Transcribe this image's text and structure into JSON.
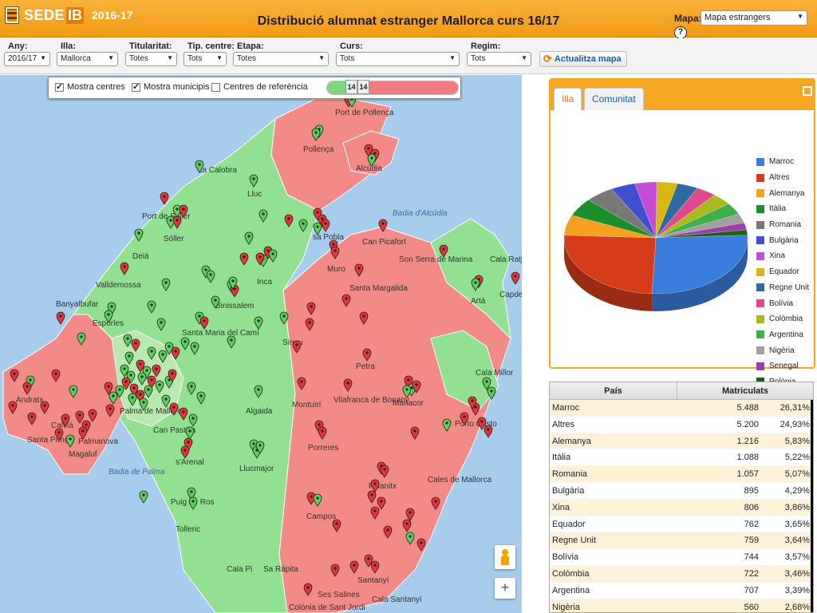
{
  "header": {
    "logo_text": "SEDE",
    "logo_ib": "IB",
    "year": "2016-17",
    "title": "Distribució alumnat estranger Mallorca curs 16/17",
    "mapa_label": "Mapa:",
    "mapa_value": "Mapa estrangers",
    "help": "?"
  },
  "filters": [
    {
      "label": "Any:",
      "value": "2016/17"
    },
    {
      "label": "Illa:",
      "value": "Mallorca"
    },
    {
      "label": "Titularitat:",
      "value": "Totes"
    },
    {
      "label": "Tip. centre:",
      "value": "Tots"
    },
    {
      "label": "Etapa:",
      "value": "Totes"
    },
    {
      "label": "Curs:",
      "value": "Tots"
    },
    {
      "label": "Regim:",
      "value": "Tots"
    }
  ],
  "refresh_label": "Actualitza mapa",
  "map": {
    "controls": {
      "show_centres": "Mostra centres",
      "show_municipis": "Mostra municipis",
      "ref_centres": "Centres de referència",
      "slider_left": "14",
      "slider_right": "14"
    },
    "zoom_in": "+",
    "labels": [
      {
        "id": "port-pollenca",
        "text": "Port de Pollença"
      },
      {
        "id": "pollenca",
        "text": "Pollença"
      },
      {
        "id": "alcudia",
        "text": "Alcúdia"
      },
      {
        "id": "la-calobra",
        "text": "La Calobra"
      },
      {
        "id": "lluc",
        "text": "Lluc"
      },
      {
        "id": "badia-alcudia",
        "text": "Badia d'Alcúdia"
      },
      {
        "id": "port-soller",
        "text": "Port de Sóller"
      },
      {
        "id": "soller",
        "text": "Sóller"
      },
      {
        "id": "deia",
        "text": "Deià"
      },
      {
        "id": "sa-pobla",
        "text": "sa Pobla"
      },
      {
        "id": "can-picafort",
        "text": "Can Picafort"
      },
      {
        "id": "valldemossa",
        "text": "Valldemossa"
      },
      {
        "id": "muro",
        "text": "Muro"
      },
      {
        "id": "son-serra",
        "text": "Son Serra de Marina"
      },
      {
        "id": "cala-ratjada",
        "text": "Cala Ratjada"
      },
      {
        "id": "inca",
        "text": "Inca"
      },
      {
        "id": "binissalem",
        "text": "Binissalem"
      },
      {
        "id": "santa-margalida",
        "text": "Santa Margalida"
      },
      {
        "id": "arta",
        "text": "Artà"
      },
      {
        "id": "banyalbufar",
        "text": "Banyalbufar"
      },
      {
        "id": "esporles",
        "text": "Esporles"
      },
      {
        "id": "santa-maria",
        "text": "Santa Maria del Camí"
      },
      {
        "id": "sineu",
        "text": "Sineu"
      },
      {
        "id": "petra",
        "text": "Petra"
      },
      {
        "id": "capdepera",
        "text": "Capdepera"
      },
      {
        "id": "cala-millor",
        "text": "Cala Millor"
      },
      {
        "id": "andratx",
        "text": "Andratx"
      },
      {
        "id": "palma",
        "text": "Palma de Mallorca"
      },
      {
        "id": "algaida",
        "text": "Algaida"
      },
      {
        "id": "montuiri",
        "text": "Montuïri"
      },
      {
        "id": "vilafranca",
        "text": "Vilafranca de Bonany"
      },
      {
        "id": "manacor",
        "text": "Manacor"
      },
      {
        "id": "porto-cristo",
        "text": "Porto Cristo"
      },
      {
        "id": "calvia",
        "text": "Calvià"
      },
      {
        "id": "can-pastilla",
        "text": "Can Pastilla"
      },
      {
        "id": "santa-ponsa",
        "text": "Santa Ponça"
      },
      {
        "id": "palmanova",
        "text": "Palmanova"
      },
      {
        "id": "magaluf",
        "text": "Magaluf"
      },
      {
        "id": "badia-palma",
        "text": "Badia de Palma"
      },
      {
        "id": "arenal",
        "text": "s'Arenal"
      },
      {
        "id": "llucmajor",
        "text": "Llucmajor"
      },
      {
        "id": "porreres",
        "text": "Porreres"
      },
      {
        "id": "felanitx",
        "text": "Felanitx"
      },
      {
        "id": "cales-mallorca",
        "text": "Cales de Mallorca"
      },
      {
        "id": "puig-ros",
        "text": "Puig de Ros"
      },
      {
        "id": "campos",
        "text": "Campos"
      },
      {
        "id": "toleric",
        "text": "Tolleric"
      },
      {
        "id": "cala-pi",
        "text": "Cala Pi"
      },
      {
        "id": "sa-rapita",
        "text": "Sa Ràpita"
      },
      {
        "id": "santanyi",
        "text": "Santanyí"
      },
      {
        "id": "ses-salines",
        "text": "Ses Salines"
      },
      {
        "id": "cala-santanyi",
        "text": "Cala Santanyí"
      },
      {
        "id": "colonia",
        "text": "Colònia de Sant Jordi"
      }
    ]
  },
  "panel": {
    "tabs": [
      "Illa",
      "Comunitat"
    ],
    "table_headers": {
      "country": "País",
      "count": "Matriculats"
    }
  },
  "chart_data": {
    "type": "pie",
    "title": "",
    "categories": [
      "Marroc",
      "Altres",
      "Alemanya",
      "Itàlia",
      "Romania",
      "Bulgària",
      "Xina",
      "Equador",
      "Regne Unit",
      "Bolívia",
      "Colòmbia",
      "Argentina",
      "Nigèria",
      "Senegal",
      "Polònia"
    ],
    "colors": [
      "#3b7ddd",
      "#d63c1c",
      "#f5a020",
      "#1c8f2a",
      "#777777",
      "#3f4fcf",
      "#c64cd6",
      "#d8b80e",
      "#2e6aa3",
      "#e04a8a",
      "#a7bb1e",
      "#3fb04a",
      "#a0a0a0",
      "#9a3fa8",
      "#1f5e18"
    ],
    "values": [
      26.31,
      24.93,
      5.83,
      5.22,
      5.07,
      4.29,
      3.86,
      3.65,
      3.64,
      3.57,
      3.46,
      3.39,
      2.68,
      2.0,
      1.5
    ]
  },
  "table_rows": [
    {
      "country": "Marroc",
      "count": "5.488",
      "pct": "26,31%"
    },
    {
      "country": "Altres",
      "count": "5.200",
      "pct": "24,93%"
    },
    {
      "country": "Alemanya",
      "count": "1.216",
      "pct": "5,83%"
    },
    {
      "country": "Itàlia",
      "count": "1.088",
      "pct": "5,22%"
    },
    {
      "country": "Romania",
      "count": "1.057",
      "pct": "5,07%"
    },
    {
      "country": "Bulgària",
      "count": "895",
      "pct": "4,29%"
    },
    {
      "country": "Xina",
      "count": "806",
      "pct": "3,86%"
    },
    {
      "country": "Equador",
      "count": "762",
      "pct": "3,65%"
    },
    {
      "country": "Regne Unit",
      "count": "759",
      "pct": "3,64%"
    },
    {
      "country": "Bolívia",
      "count": "744",
      "pct": "3,57%"
    },
    {
      "country": "Colòmbia",
      "count": "722",
      "pct": "3,46%"
    },
    {
      "country": "Argentina",
      "count": "707",
      "pct": "3,39%"
    },
    {
      "country": "Nigèria",
      "count": "560",
      "pct": "2,68%"
    }
  ]
}
